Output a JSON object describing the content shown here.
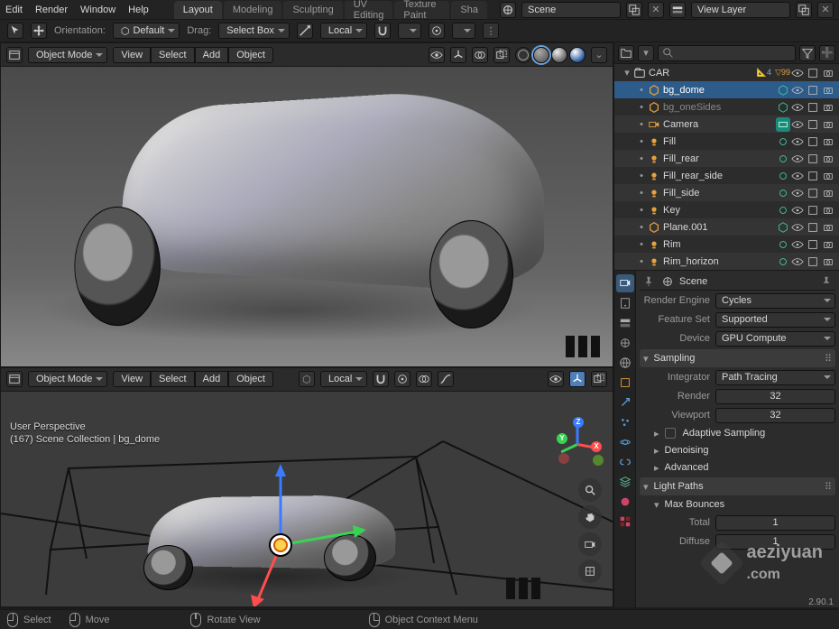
{
  "menus": {
    "edit": "Edit",
    "render": "Render",
    "window": "Window",
    "help": "Help"
  },
  "workspaces": {
    "items": [
      "Layout",
      "Modeling",
      "Sculpting",
      "UV Editing",
      "Texture Paint",
      "Sha"
    ],
    "active": 0
  },
  "top": {
    "scene_label": "Scene",
    "viewlayer_label": "View Layer"
  },
  "toolopts": {
    "orientation": "Orientation:",
    "orientation_val": "Default",
    "drag": "Drag:",
    "drag_val": "Select Box",
    "pivot": "Local"
  },
  "vheader": {
    "mode": "Object Mode",
    "view": "View",
    "select": "Select",
    "add": "Add",
    "object": "Object",
    "local": "Local"
  },
  "info": {
    "persp": "User Perspective",
    "coll": "(167) Scene Collection | bg_dome"
  },
  "outliner": {
    "search_placeholder": "",
    "items": [
      {
        "name": "CAR",
        "type": "collection",
        "badge": "4",
        "badge2": "99",
        "sel": false
      },
      {
        "name": "bg_dome",
        "type": "mesh",
        "sel": true,
        "active": true
      },
      {
        "name": "bg_oneSides",
        "type": "mesh",
        "dim": true
      },
      {
        "name": "Camera",
        "type": "camera",
        "tag": true
      },
      {
        "name": "Fill",
        "type": "light"
      },
      {
        "name": "Fill_rear",
        "type": "light"
      },
      {
        "name": "Fill_rear_side",
        "type": "light"
      },
      {
        "name": "Fill_side",
        "type": "light"
      },
      {
        "name": "Key",
        "type": "light"
      },
      {
        "name": "Plane.001",
        "type": "mesh"
      },
      {
        "name": "Rim",
        "type": "light"
      },
      {
        "name": "Rim_horizon",
        "type": "light"
      }
    ]
  },
  "props": {
    "crumb": "Scene",
    "render_engine_label": "Render Engine",
    "render_engine": "Cycles",
    "feature_set_label": "Feature Set",
    "feature_set": "Supported",
    "device_label": "Device",
    "device": "GPU Compute",
    "sampling": "Sampling",
    "integrator_label": "Integrator",
    "integrator": "Path Tracing",
    "render_label": "Render",
    "render_val": "32",
    "viewport_label": "Viewport",
    "viewport_val": "32",
    "adaptive": "Adaptive Sampling",
    "denoising": "Denoising",
    "advanced": "Advanced",
    "light_paths": "Light Paths",
    "max_bounces": "Max Bounces",
    "total_label": "Total",
    "total_val": "1",
    "diffuse_label": "Diffuse",
    "diffuse_val": "1"
  },
  "status": {
    "select": "Select",
    "move": "Move",
    "rotate": "Rotate View",
    "ctx": "Object Context Menu"
  },
  "watermark": {
    "brand": "aeziyuan",
    "site": ".com"
  },
  "version": "2.90.1"
}
